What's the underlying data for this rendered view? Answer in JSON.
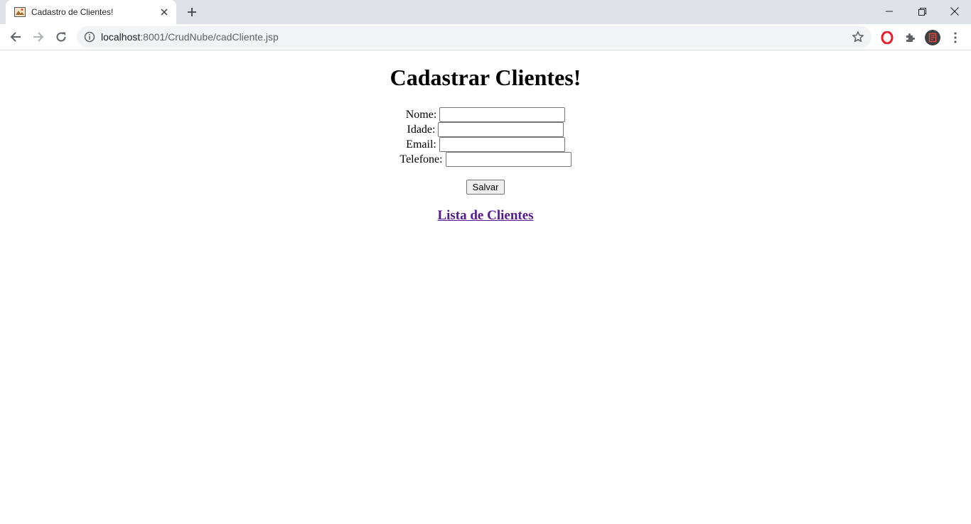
{
  "browser": {
    "tab_title": "Cadastro de Clientes!",
    "url_host": "localhost",
    "url_rest": ":8001/CrudNube/cadCliente.jsp"
  },
  "page": {
    "heading": "Cadastrar Clientes!",
    "form": {
      "fields": [
        {
          "label": "Nome:",
          "value": ""
        },
        {
          "label": "Idade:",
          "value": ""
        },
        {
          "label": "Email:",
          "value": ""
        },
        {
          "label": "Telefone:",
          "value": ""
        }
      ],
      "submit_label": "Salvar"
    },
    "list_link": "Lista de Clientes"
  },
  "colors": {
    "link_visited": "#551a8b",
    "tabstrip_bg": "#dee1e6",
    "omnibox_bg": "#f1f3f4"
  }
}
